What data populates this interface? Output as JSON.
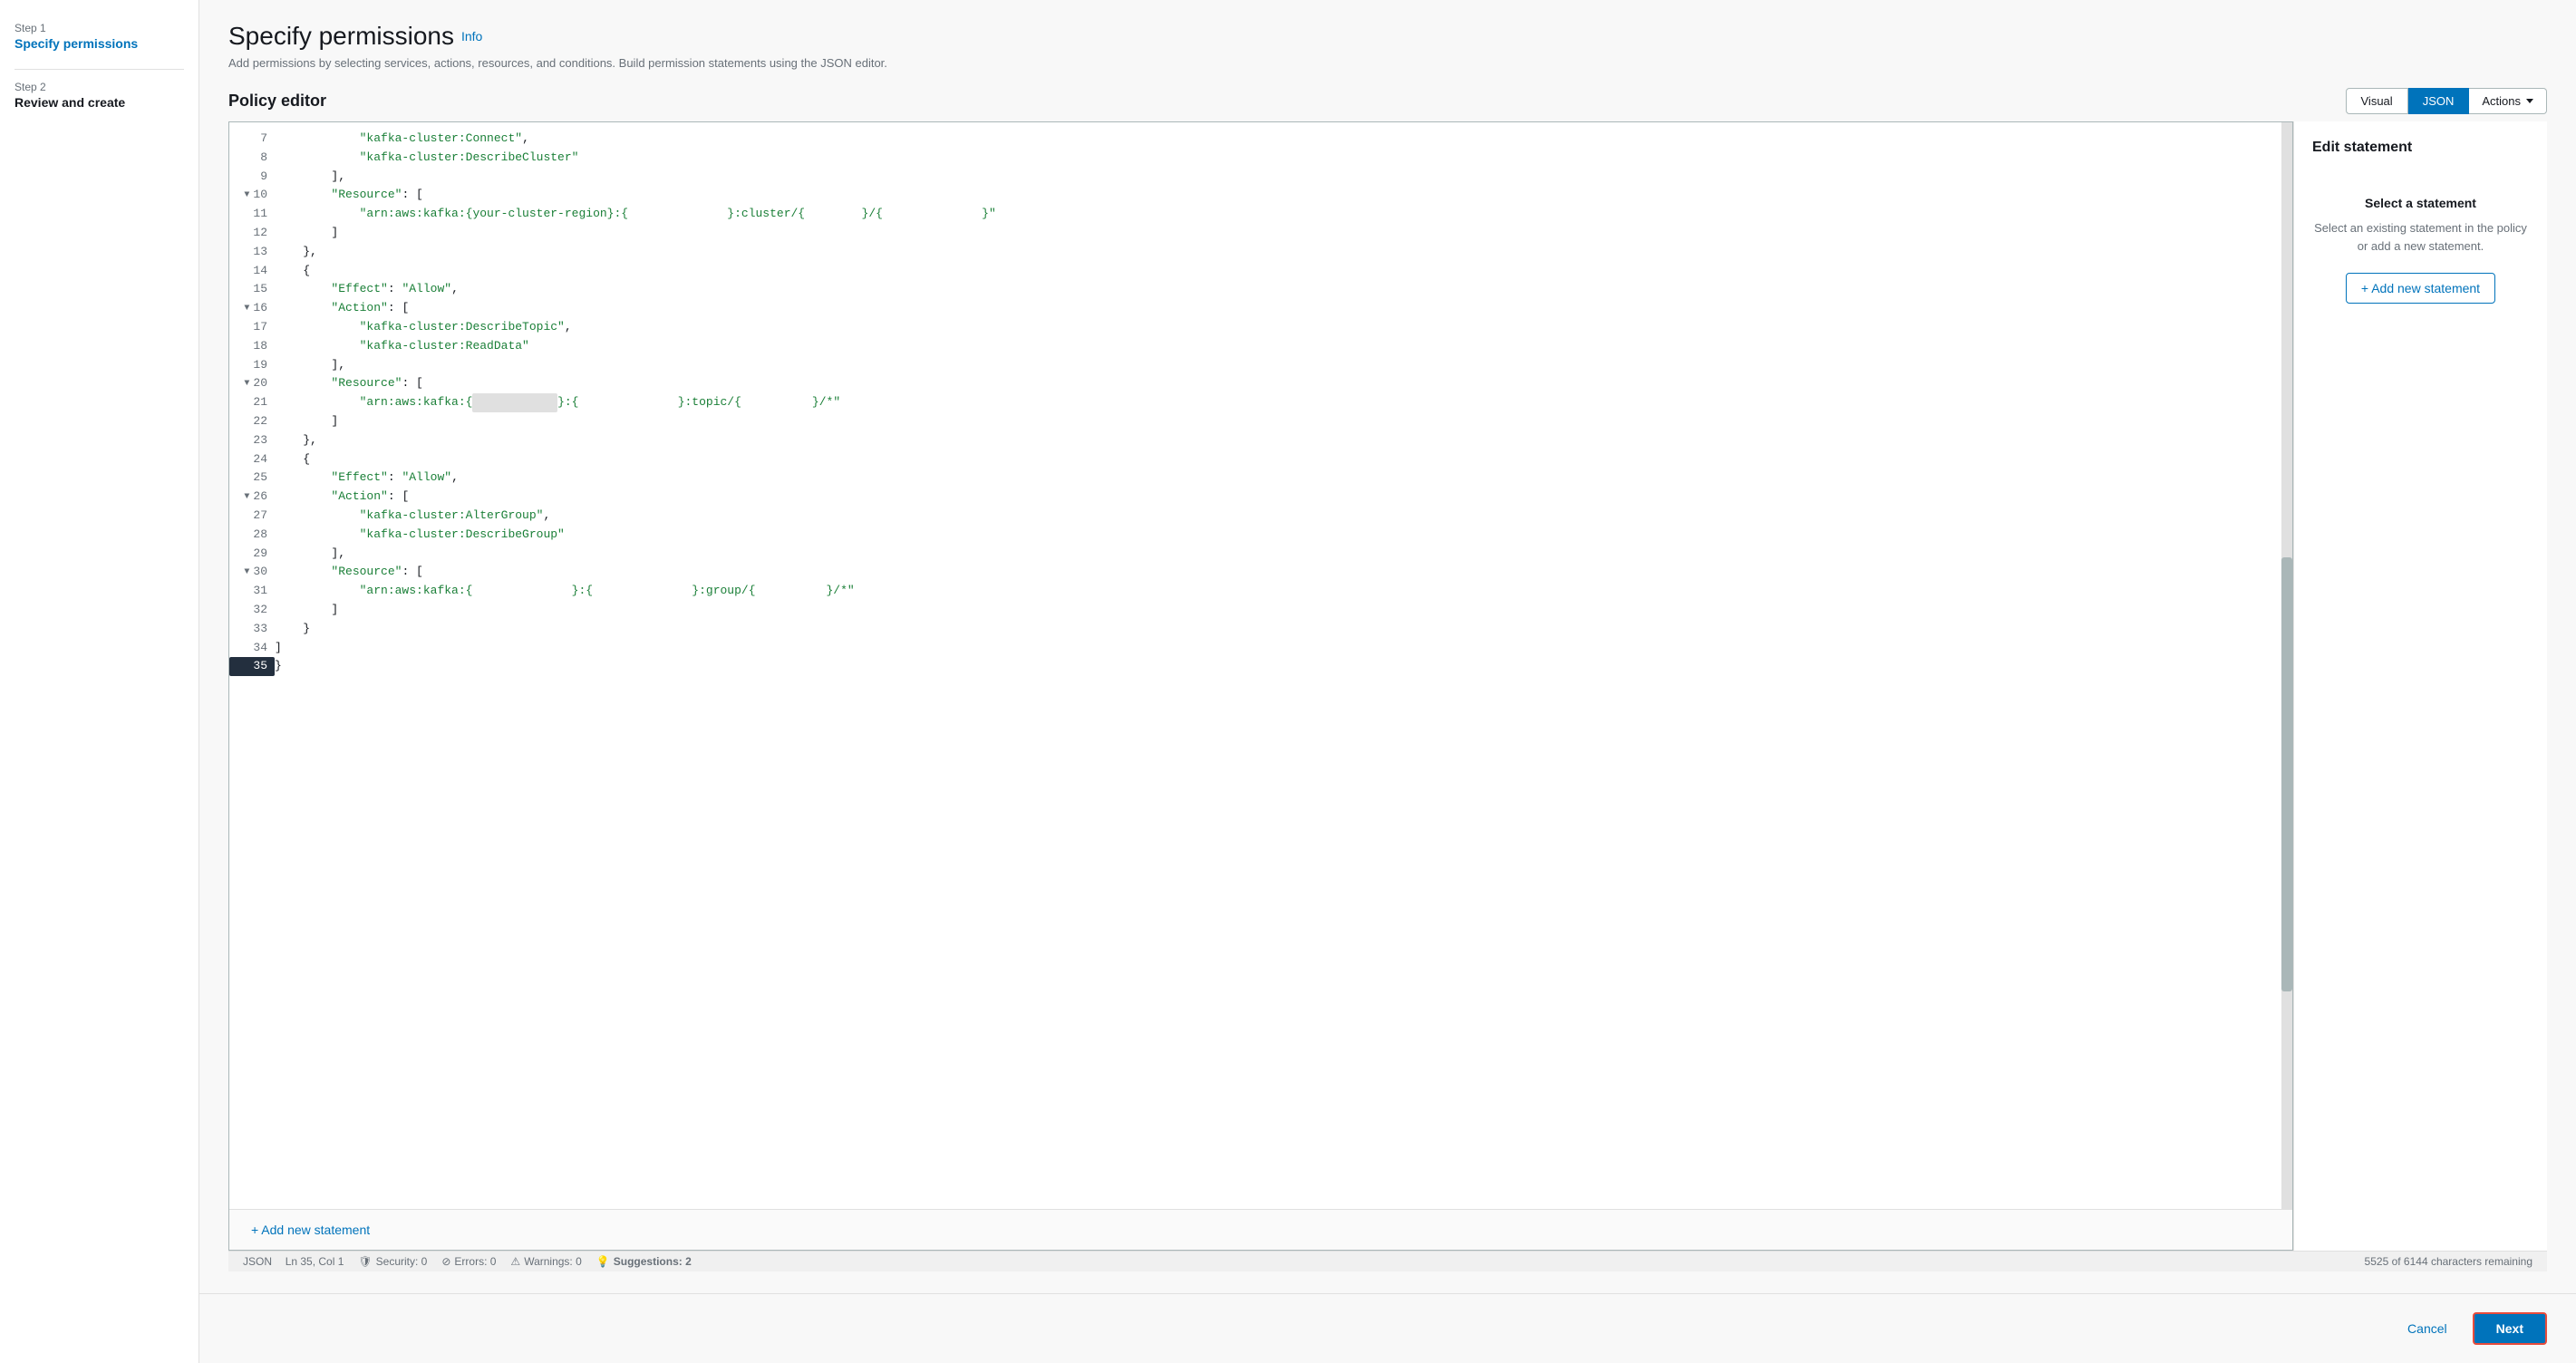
{
  "sidebar": {
    "step1_label": "Step 1",
    "step1_title": "Specify permissions",
    "step2_label": "Step 2",
    "step2_title": "Review and create"
  },
  "page": {
    "title": "Specify permissions",
    "info_link": "Info",
    "subtitle": "Add permissions by selecting services, actions, resources, and conditions. Build permission statements using the JSON editor."
  },
  "policy_editor": {
    "section_title": "Policy editor",
    "tab_visual": "Visual",
    "tab_json": "JSON",
    "tab_actions": "Actions",
    "add_statement_label": "+ Add new statement",
    "right_panel_title": "Edit statement",
    "select_statement_label": "Select a statement",
    "select_statement_desc": "Select an existing statement in the policy or add a new statement.",
    "add_new_statement_btn": "+ Add new statement",
    "status_format": "JSON",
    "status_position": "Ln 35, Col 1",
    "status_chars": "5525 of 6144 characters remaining",
    "status_security": "Security: 0",
    "status_errors": "Errors: 0",
    "status_warnings": "Warnings: 0",
    "status_suggestions": "Suggestions: 2"
  },
  "code_lines": [
    {
      "num": "7",
      "text": "            \"kafka-cluster:Connect\","
    },
    {
      "num": "8",
      "text": "            \"kafka-cluster:DescribeCluster\""
    },
    {
      "num": "9",
      "text": "        ],"
    },
    {
      "num": "10",
      "text": "        \"Resource\": [",
      "collapsible": true
    },
    {
      "num": "11",
      "text": "            \"arn:aws:kafka:{your-cluster-region}:{              }:cluster/{        }/{              }\""
    },
    {
      "num": "12",
      "text": "        ]"
    },
    {
      "num": "13",
      "text": "    },"
    },
    {
      "num": "14",
      "text": "    {"
    },
    {
      "num": "15",
      "text": "        \"Effect\": \"Allow\","
    },
    {
      "num": "16",
      "text": "        \"Action\": [",
      "collapsible": true
    },
    {
      "num": "17",
      "text": "            \"kafka-cluster:DescribeTopic\","
    },
    {
      "num": "18",
      "text": "            \"kafka-cluster:ReadData\""
    },
    {
      "num": "19",
      "text": "        ],"
    },
    {
      "num": "20",
      "text": "        \"Resource\": [",
      "collapsible": true
    },
    {
      "num": "21",
      "text": "            \"arn:aws:kafka:{        .   }:{              }:topic/{          }/*\""
    },
    {
      "num": "22",
      "text": "        ]"
    },
    {
      "num": "23",
      "text": "    },"
    },
    {
      "num": "24",
      "text": "    {"
    },
    {
      "num": "25",
      "text": "        \"Effect\": \"Allow\","
    },
    {
      "num": "26",
      "text": "        \"Action\": [",
      "collapsible": true
    },
    {
      "num": "27",
      "text": "            \"kafka-cluster:AlterGroup\","
    },
    {
      "num": "28",
      "text": "            \"kafka-cluster:DescribeGroup\""
    },
    {
      "num": "29",
      "text": "        ],"
    },
    {
      "num": "30",
      "text": "        \"Resource\": [",
      "collapsible": true
    },
    {
      "num": "31",
      "text": "            \"arn:aws:kafka:{              }:{              }:group/{          }/*\""
    },
    {
      "num": "32",
      "text": "        ]"
    },
    {
      "num": "33",
      "text": "    }"
    },
    {
      "num": "34",
      "text": "]"
    },
    {
      "num": "35",
      "text": "}",
      "highlighted": true
    }
  ],
  "footer": {
    "cancel_label": "Cancel",
    "next_label": "Next"
  }
}
